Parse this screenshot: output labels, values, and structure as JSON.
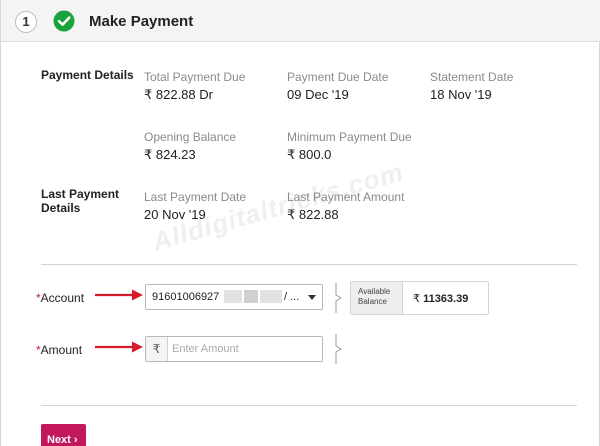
{
  "step": {
    "number": "1",
    "title": "Make Payment",
    "status_icon": "check-circle-icon",
    "status_color": "#1aa33a"
  },
  "payment_details": {
    "section_label": "Payment Details",
    "fields": [
      {
        "label": "Total Payment Due",
        "value": "₹ 822.88 Dr"
      },
      {
        "label": "Payment Due Date",
        "value": "09 Dec '19"
      },
      {
        "label": "Statement Date",
        "value": "18 Nov '19"
      },
      {
        "label": "Opening Balance",
        "value": "₹ 824.23"
      },
      {
        "label": "Minimum Payment Due",
        "value": "₹ 800.0"
      }
    ]
  },
  "last_payment": {
    "section_label_line1": "Last Payment",
    "section_label_line2": "Details",
    "fields": [
      {
        "label": "Last Payment Date",
        "value": "20 Nov '19"
      },
      {
        "label": "Last Payment Amount",
        "value": "₹ 822.88"
      }
    ]
  },
  "watermark": "Alldigitaltricks.com",
  "form": {
    "required_mark": "*",
    "account_label": "Account",
    "account_value_prefix": "91601006927",
    "account_value_suffix": "/ ...",
    "available_balance_line1": "Available",
    "available_balance_line2": "Balance",
    "available_balance_currency": "₹",
    "available_balance_amount": "11363.39",
    "amount_label": "Amount",
    "amount_currency": "₹",
    "amount_placeholder": "Enter Amount"
  },
  "actions": {
    "next_label": "Next",
    "next_chevron": "›",
    "accent_color": "#c2185b"
  }
}
